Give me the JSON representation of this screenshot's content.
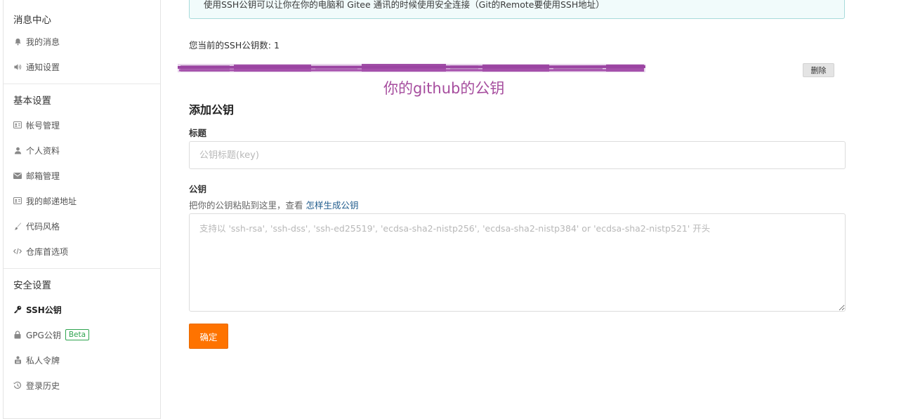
{
  "sidebar": {
    "groups": [
      {
        "title": "消息中心",
        "items": [
          {
            "label": "我的消息",
            "icon": "bell-icon"
          },
          {
            "label": "通知设置",
            "icon": "volume-icon"
          }
        ]
      },
      {
        "title": "基本设置",
        "items": [
          {
            "label": "帐号管理",
            "icon": "id-card-icon"
          },
          {
            "label": "个人资料",
            "icon": "user-icon"
          },
          {
            "label": "邮箱管理",
            "icon": "envelope-icon"
          },
          {
            "label": "我的邮递地址",
            "icon": "address-card-icon"
          },
          {
            "label": "代码风格",
            "icon": "brush-icon"
          },
          {
            "label": "仓库首选项",
            "icon": "code-icon"
          }
        ]
      },
      {
        "title": "安全设置",
        "items": [
          {
            "label": "SSH公钥",
            "icon": "key-icon",
            "active": true
          },
          {
            "label": "GPG公钥",
            "icon": "lock-icon",
            "badge": "Beta"
          },
          {
            "label": "私人令牌",
            "icon": "token-icon"
          },
          {
            "label": "登录历史",
            "icon": "history-icon"
          }
        ]
      }
    ]
  },
  "main": {
    "notice": "使用SSH公钥可以让你在你的电脑和 Gitee 通讯的时候使用安全连接（Git的Remote要使用SSH地址）",
    "ssh_count": "您当前的SSH公钥数: 1",
    "delete_label": "删除",
    "annotation": "你的github的公钥",
    "annotation_color": "#a64d9e",
    "add_title": "添加公钥",
    "title_label": "标题",
    "title_placeholder": "公钥标题(key)",
    "key_label": "公钥",
    "hint_prefix": "把你的公钥粘贴到这里，查看 ",
    "hint_link": "怎样生成公钥",
    "key_placeholder": "支持以 'ssh-rsa', 'ssh-dss', 'ssh-ed25519', 'ecdsa-sha2-nistp256', 'ecdsa-sha2-nistp384' or 'ecdsa-sha2-nistp521' 开头",
    "submit_label": "确定",
    "accent_color": "#fe7300"
  }
}
